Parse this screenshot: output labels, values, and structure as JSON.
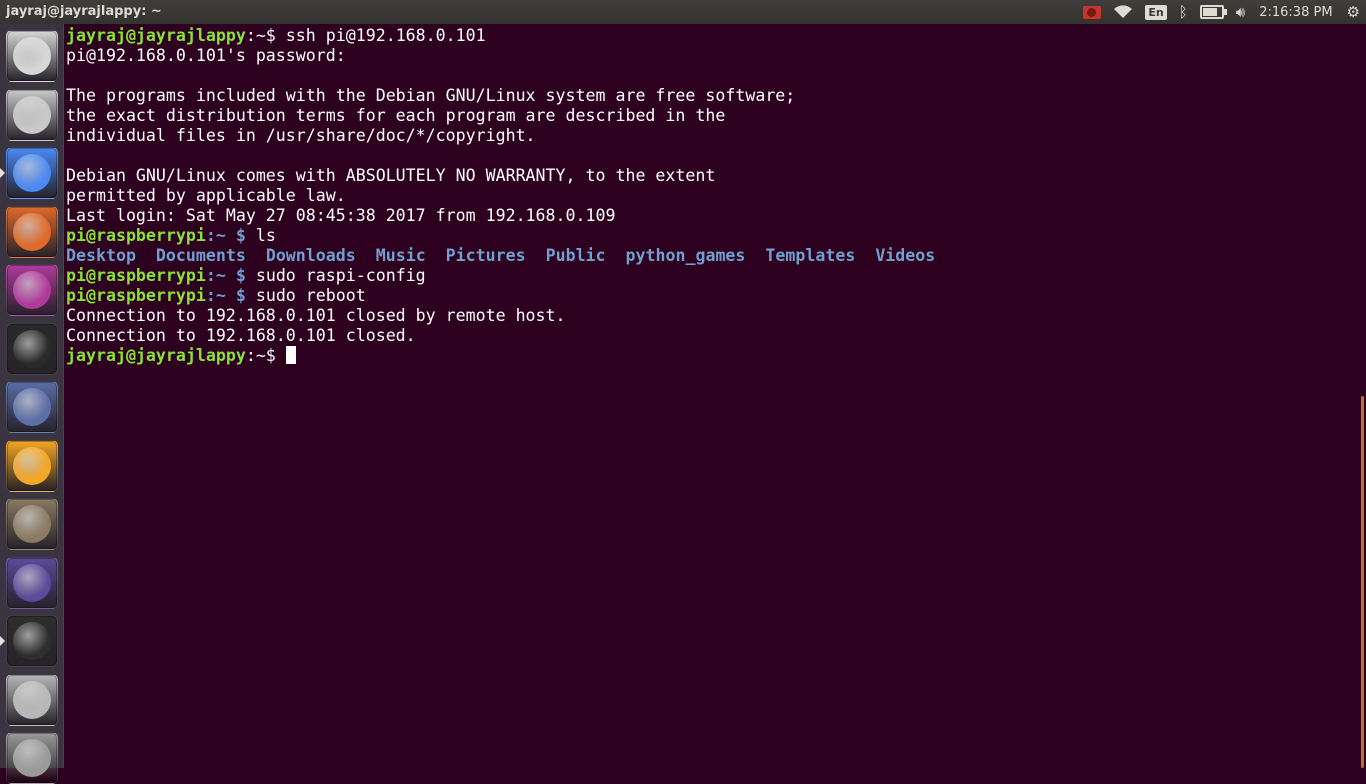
{
  "window": {
    "title": "jayraj@jayrajlappy: ~"
  },
  "tray": {
    "keyboard_layout": "En",
    "clock": "2:16:38 PM",
    "battery_level": 0.8,
    "icons": [
      "record-icon",
      "wifi-icon",
      "keyboard-layout-indicator",
      "bluetooth-icon",
      "battery-icon",
      "volume-icon",
      "power-gear-icon"
    ]
  },
  "launcher": {
    "items": [
      {
        "name": "ubuntu-dash-icon",
        "color": "#d7d7d7"
      },
      {
        "name": "files-icon",
        "color": "#c8c8c8"
      },
      {
        "name": "chrome-icon",
        "color": "#4a8af4"
      },
      {
        "name": "software-center-icon",
        "color": "#e06a2a"
      },
      {
        "name": "media-player-icon",
        "color": "#b03a9a"
      },
      {
        "name": "inkscape-icon",
        "color": "#2a2a2a"
      },
      {
        "name": "pen-tool-icon",
        "color": "#5a6ea8"
      },
      {
        "name": "audacity-icon",
        "color": "#f5a623"
      },
      {
        "name": "gimp-icon",
        "color": "#8a7a60"
      },
      {
        "name": "eclipse-icon",
        "color": "#5c4a9a"
      },
      {
        "name": "terminal-icon",
        "color": "#2e2e2e"
      },
      {
        "name": "disk-icon",
        "color": "#b8b8b8"
      },
      {
        "name": "scanner-icon",
        "color": "#9a9a9a"
      }
    ]
  },
  "colors": {
    "background": "#2c001e",
    "prompt_user": "#8ae234",
    "prompt_path": "#729fcf",
    "directory": "#729fcf"
  },
  "terminal": {
    "l1": {
      "user": "jayraj@jayrajlappy",
      "path": ":~$",
      "cmd": " ssh pi@192.168.0.101"
    },
    "l2": "pi@192.168.0.101's password:",
    "l3": "",
    "l4": "The programs included with the Debian GNU/Linux system are free software;",
    "l5": "the exact distribution terms for each program are described in the",
    "l6": "individual files in /usr/share/doc/*/copyright.",
    "l7": "",
    "l8": "Debian GNU/Linux comes with ABSOLUTELY NO WARRANTY, to the extent",
    "l9": "permitted by applicable law.",
    "l10": "Last login: Sat May 27 08:45:38 2017 from 192.168.0.109",
    "l11": {
      "user": "pi@raspberrypi",
      "path": ":~ $",
      "cmd": " ls"
    },
    "ls_dirs": [
      "Desktop",
      "Documents",
      "Downloads",
      "Music",
      "Pictures",
      "Public",
      "python_games",
      "Templates",
      "Videos"
    ],
    "l13": {
      "user": "pi@raspberrypi",
      "path": ":~ $",
      "cmd": " sudo raspi-config"
    },
    "l14": {
      "user": "pi@raspberrypi",
      "path": ":~ $",
      "cmd": " sudo reboot"
    },
    "l15": "Connection to 192.168.0.101 closed by remote host.",
    "l16": "Connection to 192.168.0.101 closed.",
    "l17": {
      "user": "jayraj@jayrajlappy",
      "path": ":~$",
      "cmd": " "
    }
  }
}
